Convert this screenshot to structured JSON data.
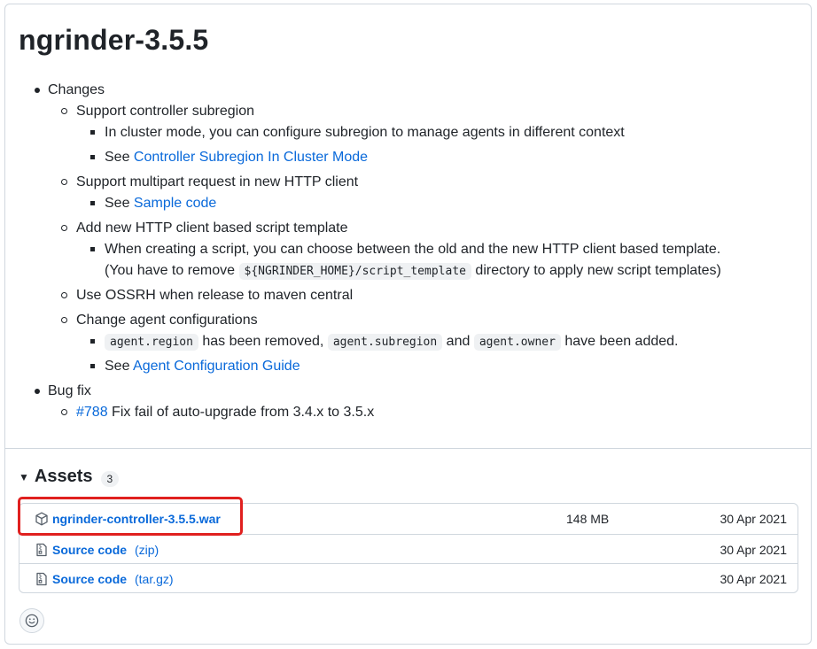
{
  "release": {
    "title": "ngrinder-3.5.5"
  },
  "notes": {
    "changes_label": "Changes",
    "support_subregion": "Support controller subregion",
    "cluster_mode_text": "In cluster mode, you can configure subregion to manage agents in different context",
    "see_label": "See",
    "subregion_link": "Controller Subregion In Cluster Mode",
    "multipart": "Support multipart request in new HTTP client",
    "sample_link": "Sample code",
    "http_template": "Add new HTTP client based script template",
    "template_text_1": "When creating a script, you can choose between the old and the new HTTP client based template.",
    "template_text_2_pre": "(You have to remove",
    "template_code": "${NGRINDER_HOME}/script_template",
    "template_text_2_post": "directory to apply new script templates)",
    "ossrh": "Use OSSRH when release to maven central",
    "agent_config": "Change agent configurations",
    "code_region": "agent.region",
    "removed_text": "has been removed,",
    "code_subregion": "agent.subregion",
    "and_text": "and",
    "code_owner": "agent.owner",
    "added_text": "have been added.",
    "agent_guide_link": "Agent Configuration Guide",
    "bugfix_label": "Bug fix",
    "issue_link": "#788",
    "issue_text": "Fix fail of auto-upgrade from 3.4.x to 3.5.x"
  },
  "assets": {
    "title": "Assets",
    "count": "3",
    "items": [
      {
        "name": "ngrinder-controller-3.5.5.war",
        "suffix": "",
        "size": "148 MB",
        "date": "30 Apr 2021",
        "icon": "package-icon"
      },
      {
        "name": "Source code",
        "suffix": "(zip)",
        "size": "",
        "date": "30 Apr 2021",
        "icon": "file-zip-icon"
      },
      {
        "name": "Source code",
        "suffix": "(tar.gz)",
        "size": "",
        "date": "30 Apr 2021",
        "icon": "file-zip-icon"
      }
    ]
  },
  "colors": {
    "link": "#0969da",
    "highlight": "#e0201f",
    "border": "#d0d7de"
  }
}
